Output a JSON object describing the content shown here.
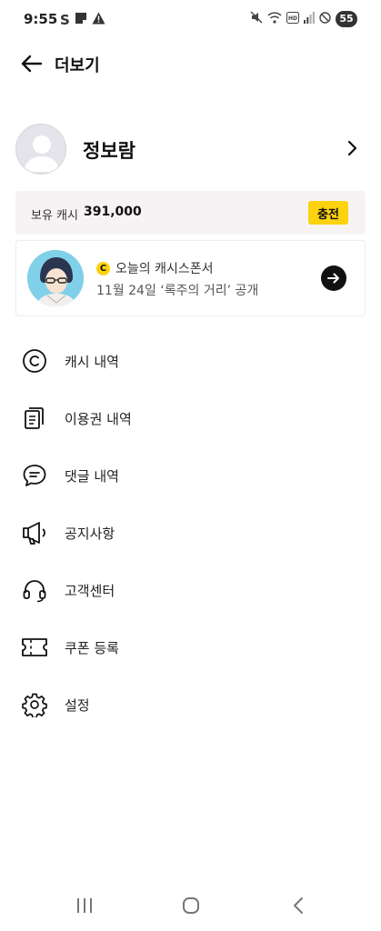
{
  "status_bar": {
    "time": "9:55",
    "left_icons": [
      "s-app-icon",
      "notes-icon",
      "warning-icon"
    ],
    "right_icons": [
      "mute-icon",
      "wifi-icon",
      "hd-voice-icon",
      "signal-icon",
      "block-icon"
    ],
    "battery": "55"
  },
  "header": {
    "title": "더보기"
  },
  "profile": {
    "name": "정보람"
  },
  "cash": {
    "label": "보유 캐시",
    "amount": "391,000",
    "charge_label": "충전"
  },
  "sponsor": {
    "title": "오늘의 캐시스폰서",
    "subtitle": "11월 24일 ‘록주의 거리’ 공개",
    "coin_glyph": "C"
  },
  "menu": {
    "items": [
      {
        "label": "캐시 내역",
        "icon": "copyright-icon"
      },
      {
        "label": "이용권 내역",
        "icon": "documents-icon"
      },
      {
        "label": "댓글 내역",
        "icon": "chat-bubble-icon"
      },
      {
        "label": "공지사항",
        "icon": "megaphone-icon"
      },
      {
        "label": "고객센터",
        "icon": "headset-icon"
      },
      {
        "label": "쿠폰 등록",
        "icon": "coupon-icon"
      },
      {
        "label": "설정",
        "icon": "gear-icon"
      }
    ]
  },
  "nav": {
    "buttons": [
      "recent-apps-icon",
      "home-icon",
      "back-icon"
    ]
  },
  "colors": {
    "accent": "#fdd20e",
    "cash_bar_bg": "#f7f3f5"
  }
}
